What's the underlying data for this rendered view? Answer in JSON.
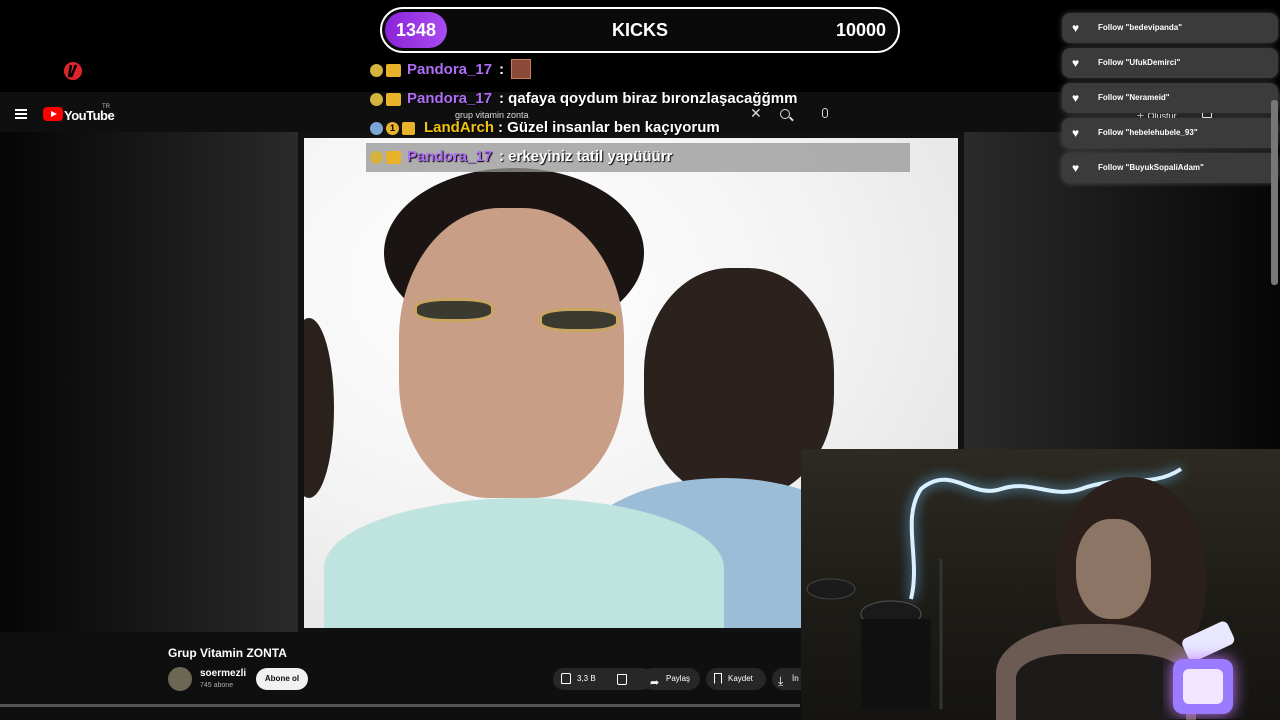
{
  "kicks": {
    "current": "1348",
    "label": "KICKS",
    "goal": "10000",
    "progress_fraction": 0.1348
  },
  "youtube": {
    "brand": "YouTube",
    "region": "TR",
    "search_query": "grup vitamin zonta",
    "create_label": "Oluştur",
    "video": {
      "title": "Grup Vitamin ZONTA",
      "channel": "soermezli",
      "subscribers": "745 abone",
      "subscribe_label": "Abone ol",
      "likes": "3,3 B",
      "share_label": "Paylaş",
      "save_label": "Kaydet",
      "download_label": "İn"
    }
  },
  "chat": [
    {
      "user": "Pandora_17",
      "message": ":",
      "user_color": "#b06cf7",
      "highlight": false,
      "badges": [
        "emoji-badge",
        "crown-badge"
      ],
      "emote": "meme-emote"
    },
    {
      "user": "Pandora_17",
      "message": ": qafaya qoydum biraz bıronzlaşacağğmm",
      "user_color": "#b06cf7",
      "highlight": false,
      "badges": [
        "emoji-badge",
        "crown-badge"
      ]
    },
    {
      "user": "LandArch",
      "message": ": Güzel insanlar ben kaçıyorum",
      "user_color": "#f1c40f",
      "highlight": false,
      "badges": [
        "emoji-badge",
        "one-badge",
        "crown-badge"
      ]
    },
    {
      "user": "Pandora_17",
      "message": ": erkeyiniz tatil yapüüürr",
      "user_color": "#b06cf7",
      "highlight": true,
      "badges": [
        "emoji-badge",
        "crown-badge"
      ]
    }
  ],
  "follows": [
    {
      "text": "Follow \"bedevipanda\""
    },
    {
      "text": "Follow \"UfukDemirci\""
    },
    {
      "text": "Follow \"Nerameid\""
    },
    {
      "text": "Follow \"hebelehubele_93\""
    },
    {
      "text": "Follow \"BuyukSopaliAdam\""
    }
  ],
  "colors": {
    "kick_purple": "#8b24d8",
    "youtube_red": "#ff0000",
    "neon": "#cfe9ff"
  }
}
